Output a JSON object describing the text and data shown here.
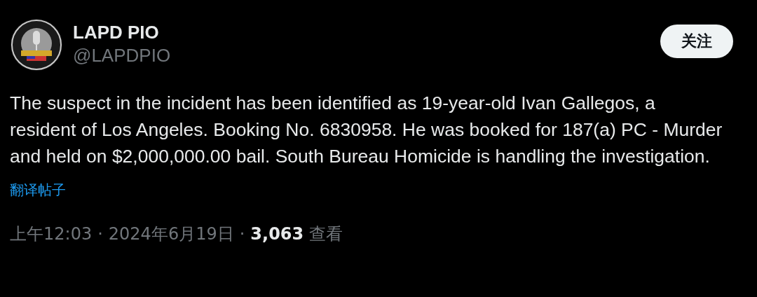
{
  "author": {
    "name": "LAPD PIO",
    "handle": "@LAPDPIO"
  },
  "follow_button": {
    "label": "关注"
  },
  "post_text": "The suspect in the incident has been identified as 19-year-old Ivan Gallegos, a resident of Los Angeles. Booking No. 6830958. He was booked for 187(a) PC - Murder and held on $2,000,000.00 bail. South Bureau Homicide is handling the investigation.",
  "translate_link": "翻译帖子",
  "meta": {
    "time": "上午12:03",
    "separator": "·",
    "date": "2024年6月19日",
    "views_count": "3,063",
    "views_label": "查看"
  }
}
